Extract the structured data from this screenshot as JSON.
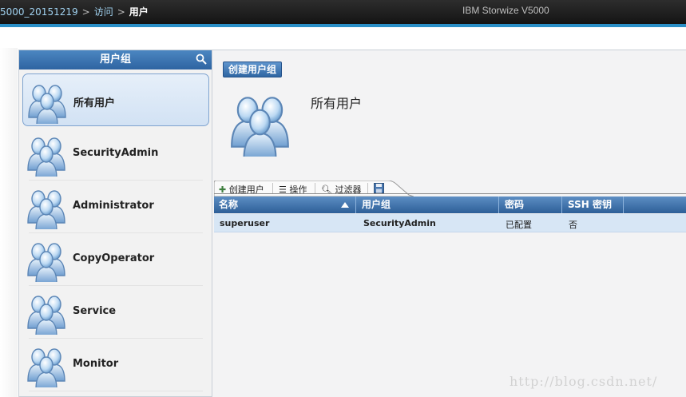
{
  "breadcrumb": {
    "system": "5000_20151219",
    "access": "访问",
    "current": "用户",
    "separator": ">"
  },
  "product_name": "IBM Storwize V5000",
  "user_groups_panel": {
    "title": "用户组",
    "items": [
      {
        "label": "所有用户",
        "selected": true
      },
      {
        "label": "SecurityAdmin"
      },
      {
        "label": "Administrator"
      },
      {
        "label": "CopyOperator"
      },
      {
        "label": "Service"
      },
      {
        "label": "Monitor"
      }
    ]
  },
  "main": {
    "create_group_button": "创建用户组",
    "group_title": "所有用户",
    "toolbar": {
      "create_user": "创建用户",
      "actions": "操作",
      "filter": "过滤器"
    },
    "table": {
      "columns": [
        "名称",
        "用户组",
        "密码",
        "SSH 密钥"
      ],
      "sorted_column": "名称",
      "rows": [
        {
          "name": "superuser",
          "group": "SecurityAdmin",
          "password": "已配置",
          "ssh_key": "否"
        }
      ]
    }
  },
  "watermark": "http://blog.csdn.net/",
  "colors": {
    "accent": "#2e64a1",
    "topbar": "#1e1e1e",
    "selected_row": "#d7e6f5"
  }
}
